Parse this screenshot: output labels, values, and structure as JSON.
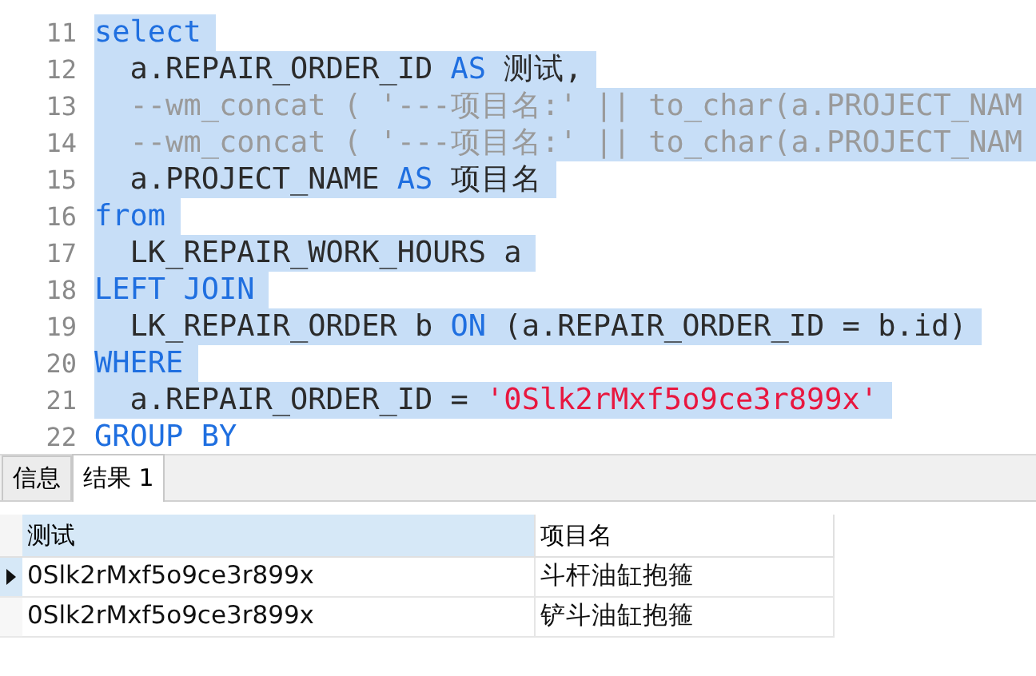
{
  "editor": {
    "lines": [
      {
        "number": "11",
        "selected": true,
        "indent": false,
        "tokens": [
          {
            "kind": "keyword",
            "text": "select"
          }
        ]
      },
      {
        "number": "12",
        "selected": true,
        "indent": true,
        "tokens": [
          {
            "kind": "plain",
            "text": "a.REPAIR_ORDER_ID "
          },
          {
            "kind": "keyword",
            "text": "AS"
          },
          {
            "kind": "plain",
            "text": " 测试,"
          }
        ]
      },
      {
        "number": "13",
        "selected": true,
        "indent": true,
        "tokens": [
          {
            "kind": "comment",
            "text": "--wm_concat ( '---项目名:' || to_char(a.PROJECT_NAM"
          }
        ]
      },
      {
        "number": "14",
        "selected": true,
        "indent": true,
        "tokens": [
          {
            "kind": "comment",
            "text": "--wm_concat ( '---项目名:' || to_char(a.PROJECT_NAM"
          }
        ]
      },
      {
        "number": "15",
        "selected": true,
        "indent": true,
        "tokens": [
          {
            "kind": "plain",
            "text": "a.PROJECT_NAME "
          },
          {
            "kind": "keyword",
            "text": "AS"
          },
          {
            "kind": "plain",
            "text": " 项目名"
          }
        ]
      },
      {
        "number": "16",
        "selected": true,
        "indent": false,
        "tokens": [
          {
            "kind": "keyword",
            "text": "from"
          }
        ]
      },
      {
        "number": "17",
        "selected": true,
        "indent": true,
        "tokens": [
          {
            "kind": "plain",
            "text": "LK_REPAIR_WORK_HOURS a"
          }
        ]
      },
      {
        "number": "18",
        "selected": true,
        "indent": false,
        "tokens": [
          {
            "kind": "keyword",
            "text": "LEFT JOIN"
          }
        ]
      },
      {
        "number": "19",
        "selected": true,
        "indent": true,
        "tokens": [
          {
            "kind": "plain",
            "text": "LK_REPAIR_ORDER b "
          },
          {
            "kind": "keyword",
            "text": "ON"
          },
          {
            "kind": "plain",
            "text": " (a.REPAIR_ORDER_ID = b.id)"
          }
        ]
      },
      {
        "number": "20",
        "selected": true,
        "indent": false,
        "tokens": [
          {
            "kind": "keyword",
            "text": "WHERE"
          }
        ]
      },
      {
        "number": "21",
        "selected": true,
        "indent": true,
        "tokens": [
          {
            "kind": "plain",
            "text": "a.REPAIR_ORDER_ID = "
          },
          {
            "kind": "string",
            "text": "'0Slk2rMxf5o9ce3r899x'"
          }
        ]
      },
      {
        "number": "22",
        "selected": false,
        "indent": false,
        "tokens": [
          {
            "kind": "keyword",
            "text": "GROUP BY"
          }
        ]
      }
    ]
  },
  "tabs": [
    {
      "label": "信息",
      "selected": false
    },
    {
      "label": "结果 1",
      "selected": true
    }
  ],
  "table": {
    "columns": [
      {
        "label": "测试",
        "selected": true
      },
      {
        "label": "项目名",
        "selected": false
      }
    ],
    "rows": [
      {
        "current": true,
        "cells": [
          "0Slk2rMxf5o9ce3r899x",
          "斗杆油缸抱箍"
        ]
      },
      {
        "current": false,
        "cells": [
          "0Slk2rMxf5o9ce3r899x",
          "铲斗油缸抱箍"
        ]
      }
    ]
  }
}
